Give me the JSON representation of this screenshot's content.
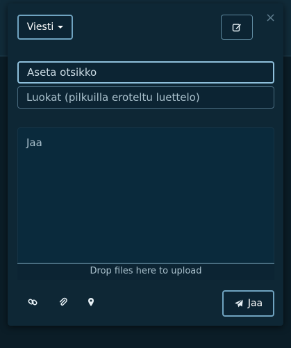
{
  "composer": {
    "type_dropdown_label": "Viesti",
    "title_placeholder": "Aseta otsikko",
    "tags_placeholder": "Luokat (pilkuilla eroteltu luettelo)",
    "body_placeholder": "Jaa",
    "dropzone_text": "Drop files here to upload",
    "share_label": "Jaa",
    "close_label": "×"
  },
  "icons": {
    "edit": "edit-icon",
    "link": "link-icon",
    "attach": "paperclip-icon",
    "location": "map-marker-icon",
    "send": "paper-plane-icon"
  },
  "colors": {
    "background": "#0b1d27",
    "modal": "#0e2735",
    "accent_border": "#6fa3c0",
    "text": "#c9d9e2"
  }
}
